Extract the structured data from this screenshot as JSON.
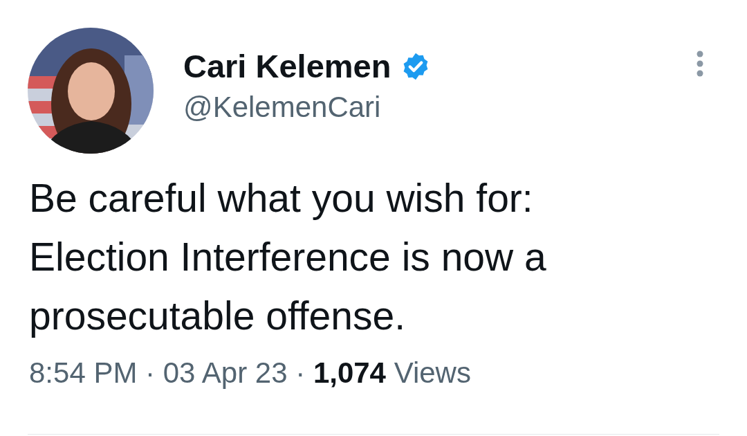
{
  "author": {
    "name": "Cari Kelemen",
    "verified": true,
    "handle": "@KelemenCari"
  },
  "tweet": {
    "text": "Be careful what you wish for: Election Interference is now a prosecutable offense."
  },
  "meta": {
    "text": "8:54 PM · 03 Apr 23 · **1,074** Views"
  }
}
